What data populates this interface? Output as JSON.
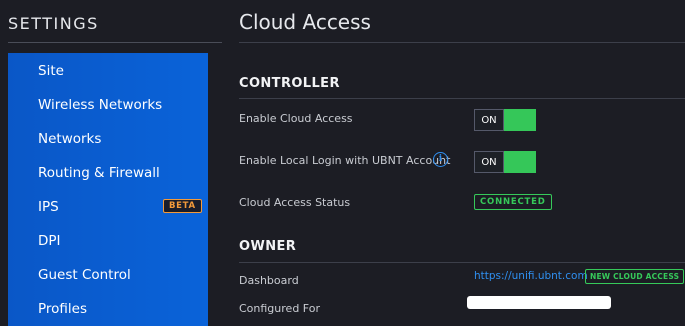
{
  "sidebar": {
    "title": "SETTINGS",
    "items": [
      {
        "label": "Site"
      },
      {
        "label": "Wireless Networks"
      },
      {
        "label": "Networks"
      },
      {
        "label": "Routing & Firewall"
      },
      {
        "label": "IPS",
        "badge": "BETA"
      },
      {
        "label": "DPI"
      },
      {
        "label": "Guest Control"
      },
      {
        "label": "Profiles"
      }
    ]
  },
  "main": {
    "title": "Cloud Access",
    "controller": {
      "heading": "CONTROLLER",
      "enable_cloud_access": {
        "label": "Enable Cloud Access",
        "toggle": "ON"
      },
      "enable_local_login": {
        "label": "Enable Local Login with UBNT Account",
        "toggle": "ON"
      },
      "status": {
        "label": "Cloud Access Status",
        "value": "CONNECTED"
      }
    },
    "owner": {
      "heading": "OWNER",
      "dashboard": {
        "label": "Dashboard",
        "link": "https://unifi.ubnt.com",
        "badge": "NEW CLOUD ACCESS"
      },
      "configured_for": {
        "label": "Configured For"
      }
    }
  },
  "colors": {
    "background": "#1c1d24",
    "nav_active_blue": "#0a5fd3",
    "toggle_green": "#35c759",
    "badge_orange": "#f39a3a",
    "link_blue": "#2f8ff0"
  },
  "icons": [
    "info-icon"
  ]
}
